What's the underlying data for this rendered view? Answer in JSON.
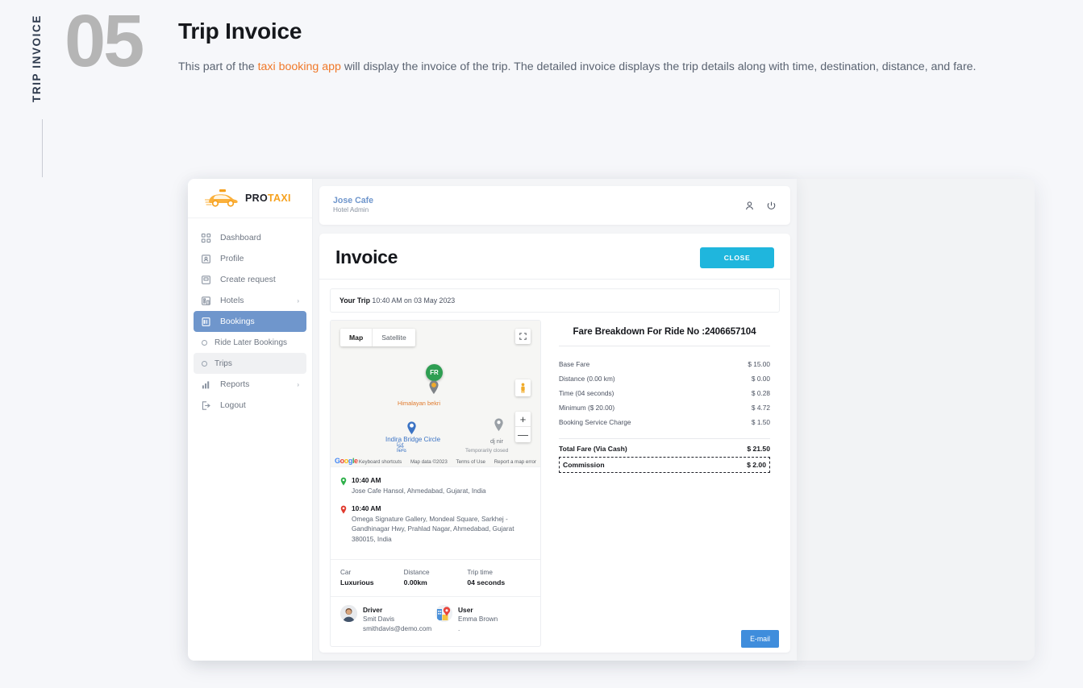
{
  "page": {
    "side_label": "TRIP INVOICE",
    "number": "05",
    "title": "Trip Invoice",
    "desc_before": "This part of the ",
    "desc_link": "taxi booking app",
    "desc_after": " will display the invoice of the trip. The detailed invoice displays the trip details along with time, destination, distance, and fare.",
    "accent": "#f0792a"
  },
  "sidebar": {
    "logo": {
      "pro": "PRO",
      "taxi": "TAXI"
    },
    "items": [
      {
        "label": "Dashboard",
        "icon": "grid-icon",
        "caret": "",
        "state": "normal"
      },
      {
        "label": "Profile",
        "icon": "profile-card-icon",
        "caret": "",
        "state": "normal"
      },
      {
        "label": "Create request",
        "icon": "create-request-icon",
        "caret": "",
        "state": "normal"
      },
      {
        "label": "Hotels",
        "icon": "hotel-icon",
        "caret": "›",
        "state": "normal"
      },
      {
        "label": "Bookings",
        "icon": "bookings-icon",
        "caret": "ⱟ",
        "state": "active"
      },
      {
        "label": "Ride Later Bookings",
        "icon": "circle-icon",
        "caret": "",
        "state": "sub"
      },
      {
        "label": "Trips",
        "icon": "circle-icon",
        "caret": "",
        "state": "sub-highlight"
      },
      {
        "label": "Reports",
        "icon": "bar-chart-icon",
        "caret": "›",
        "state": "normal"
      },
      {
        "label": "Logout",
        "icon": "logout-icon",
        "caret": "",
        "state": "normal"
      }
    ],
    "active_color": "#6f96cc"
  },
  "topbar": {
    "name": "Jose Cafe",
    "role": "Hotel Admin",
    "icons": [
      "user-icon",
      "power-icon"
    ]
  },
  "invoice": {
    "title": "Invoice",
    "close_label": "CLOSE",
    "close_color": "#1fb6dd",
    "your_trip_label": "Your Trip",
    "your_trip_value": "10:40 AM on 03 May 2023",
    "email_label": "E-mail",
    "email_color": "#3f8ddc"
  },
  "map": {
    "tabs": [
      {
        "label": "Map",
        "selected": true
      },
      {
        "label": "Satellite",
        "selected": false
      }
    ],
    "marker_label": "FR",
    "places": [
      {
        "name": "Himalayan bekri",
        "color": "#e07a2d"
      },
      {
        "name": "Indira Bridge Circle",
        "color": "#3b73c4"
      },
      {
        "name": "હિંદુ",
        "color": "#3b73c4"
      },
      {
        "name": "બ્રિજ",
        "color": "#3b73c4"
      },
      {
        "name": "dj nir",
        "color": "#6b7078"
      },
      {
        "name": "Temporarily closed",
        "color": "#8a8f97"
      }
    ],
    "watermark": "Google",
    "footer": [
      "Keyboard shortcuts",
      "Map data ©2023",
      "Terms of Use",
      "Report a map error"
    ],
    "zoom_in": "+",
    "zoom_out": "—"
  },
  "trip": {
    "pickup": {
      "time": "10:40 AM",
      "address": "Jose Cafe Hansol, Ahmedabad, Gujarat, India",
      "pin_color": "#2eb04a"
    },
    "dropoff": {
      "time": "10:40 AM",
      "address": "Omega Signature Gallery, Mondeal Square, Sarkhej - Gandhinagar Hwy, Prahlad Nagar, Ahmedabad, Gujarat 380015, India",
      "pin_color": "#e03b2f"
    },
    "meta": [
      {
        "key": "Car",
        "value": "Luxurious"
      },
      {
        "key": "Distance",
        "value": "0.00km"
      },
      {
        "key": "Trip time",
        "value": "04 seconds"
      }
    ],
    "driver": {
      "role": "Driver",
      "name": "Smit Davis",
      "email": "smithdavis@demo.com",
      "avatar": "driver-avatar"
    },
    "user": {
      "role": "User",
      "name": "Emma Brown",
      "email": ".",
      "avatar": "user-avatar"
    }
  },
  "fare": {
    "title": "Fare Breakdown For Ride No :2406657104",
    "rows": [
      {
        "label": "Base Fare",
        "amount": "$ 15.00"
      },
      {
        "label": "Distance (0.00 km)",
        "amount": "$ 0.00"
      },
      {
        "label": "Time (04 seconds)",
        "amount": "$ 0.28"
      },
      {
        "label": "Minimum ($ 20.00)",
        "amount": "$ 4.72"
      },
      {
        "label": "Booking Service Charge",
        "amount": "$ 1.50"
      }
    ],
    "total": {
      "label": "Total Fare (Via Cash)",
      "amount": "$ 21.50"
    },
    "commission": {
      "label": "Commission",
      "amount": "$ 2.00"
    }
  }
}
